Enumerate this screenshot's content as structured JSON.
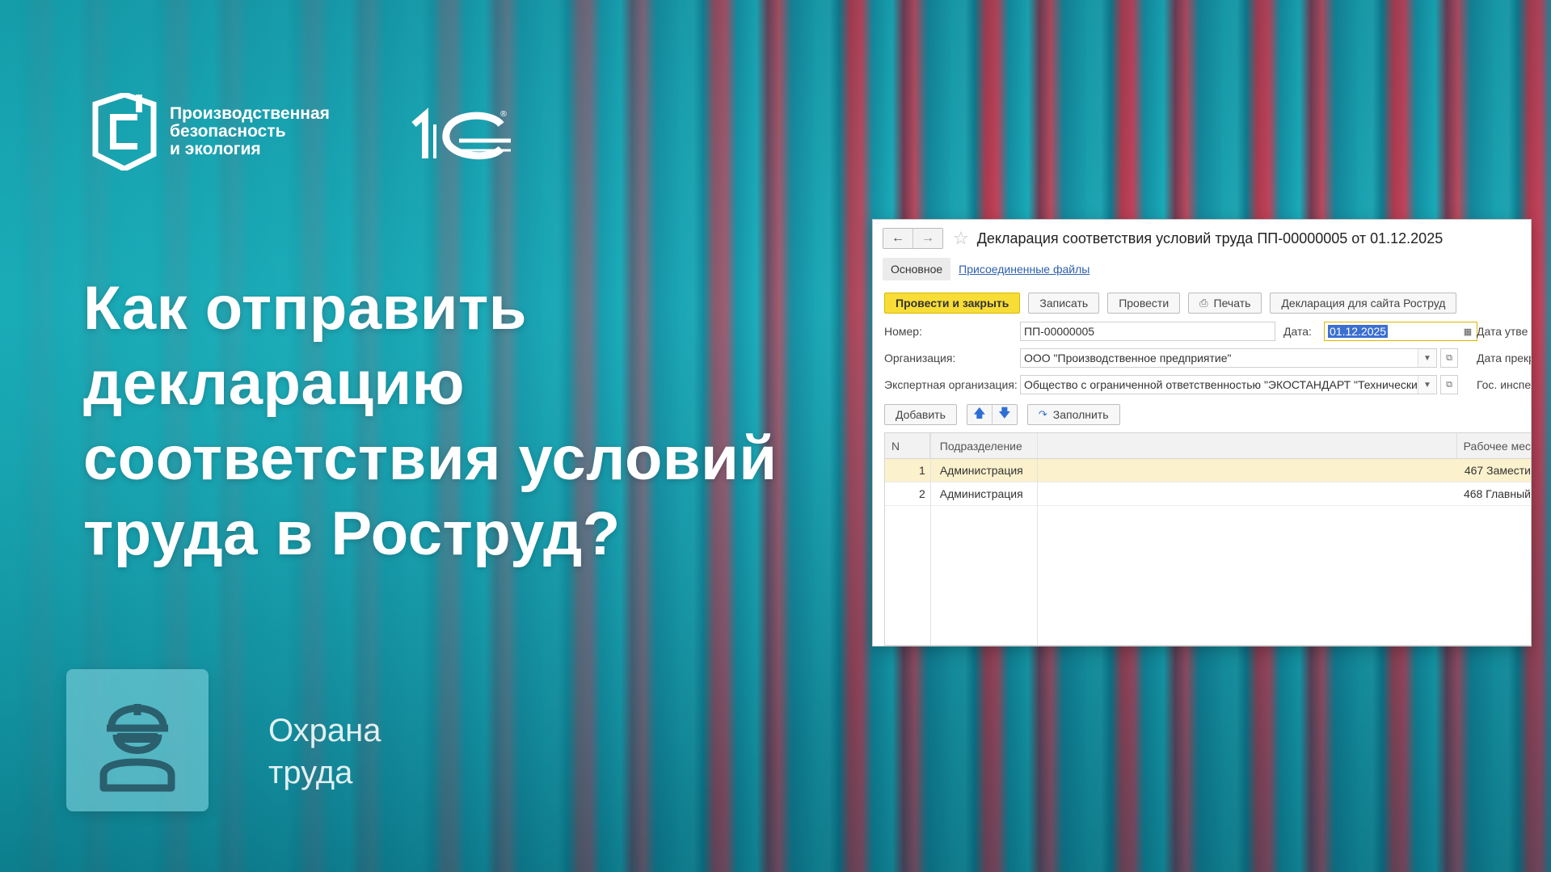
{
  "brand": {
    "psb_line1": "Производственная",
    "psb_line2": "безопасность",
    "psb_line3": "и экология",
    "onec_mark": "®"
  },
  "headline": {
    "line1": "Как отправить",
    "line2": "декларацию",
    "line3": "соответствия условий",
    "line4": "труда в Роструд?"
  },
  "category": {
    "line1": "Охрана",
    "line2": "труда"
  },
  "window": {
    "title": "Декларация соответствия условий труда ПП-00000005 от 01.12.2025",
    "tabs": {
      "main": "Основное",
      "files": "Присоединенные файлы"
    },
    "toolbar": {
      "post_close": "Провести и закрыть",
      "save": "Записать",
      "post": "Провести",
      "print": "Печать",
      "rostrud": "Декларация для сайта Роструд"
    },
    "form": {
      "number_label": "Номер:",
      "number_value": "ПП-00000005",
      "date_label": "Дата:",
      "date_value": "01.12.2025",
      "approve_label": "Дата утве",
      "org_label": "Организация:",
      "org_value": "ООО \"Производственное предприятие\"",
      "term_label": "Дата прекр",
      "expert_label": "Экспертная организация:",
      "expert_value": "Общество с ограниченной ответственностью \"ЭКОСТАНДАРТ \"Технические ре",
      "gov_label": "Гос. инспе"
    },
    "table_toolbar": {
      "add": "Добавить",
      "fill": "Заполнить"
    },
    "table": {
      "headers": [
        "N",
        "Подразделение",
        "Рабочее мес"
      ],
      "rows": [
        {
          "n": "1",
          "dept": "Администрация",
          "place": "467 Замести"
        },
        {
          "n": "2",
          "dept": "Администрация",
          "place": "468 Главный"
        }
      ]
    }
  }
}
